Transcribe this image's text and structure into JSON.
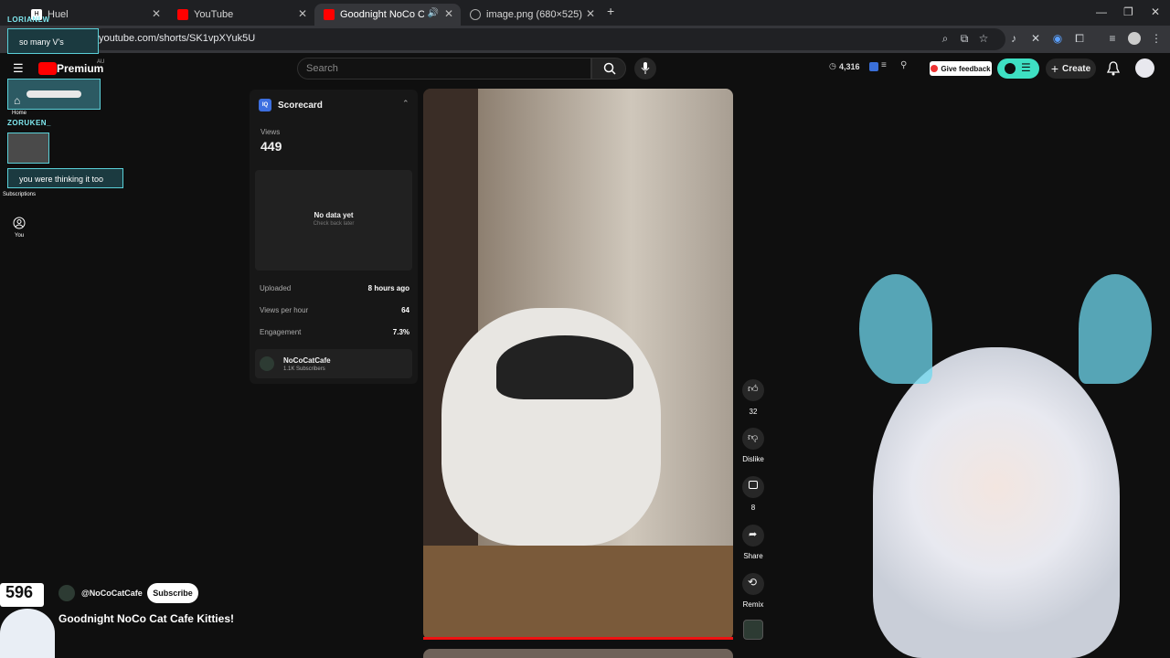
{
  "browser": {
    "tabs": [
      {
        "label": "Huel",
        "active": false
      },
      {
        "label": "YouTube",
        "active": false
      },
      {
        "label": "Goodnight NoCo Cat Cafe",
        "active": true
      },
      {
        "label": "image.png (680×525)",
        "active": false
      }
    ],
    "url": "youtube.com/shorts/SK1vpXYuk5U"
  },
  "overlay": {
    "user1": "LORIANLW",
    "chat1": "so many V's",
    "user2": "ZORUKEN_",
    "chat2": "you were thinking it too",
    "stream_counter": "596"
  },
  "yt": {
    "logo_text": "Premium",
    "country": "AU",
    "search_placeholder": "Search",
    "stats_count": "4,316",
    "feedback": "Give feedback",
    "create": "Create",
    "nav": [
      {
        "label": "Home"
      },
      {
        "label": "Subscriptions"
      },
      {
        "label": "You"
      }
    ]
  },
  "scorecard": {
    "title": "Scorecard",
    "views_label": "Views",
    "views_value": "449",
    "no_data": "No data yet",
    "check_back": "Check back later",
    "rows": [
      {
        "label": "Uploaded",
        "value": "8 hours ago"
      },
      {
        "label": "Views per hour",
        "value": "64"
      },
      {
        "label": "Engagement",
        "value": "7.3%"
      }
    ],
    "channel_name": "NoCoCatCafe",
    "channel_subs": "1.1K Subscribers"
  },
  "actions": {
    "likes": "32",
    "dislike": "Dislike",
    "comments": "8",
    "share": "Share",
    "remix": "Remix"
  },
  "channel": {
    "handle": "@NoCoCatCafe",
    "subscribe": "Subscribe",
    "title": "Goodnight NoCo Cat Cafe Kitties!"
  }
}
